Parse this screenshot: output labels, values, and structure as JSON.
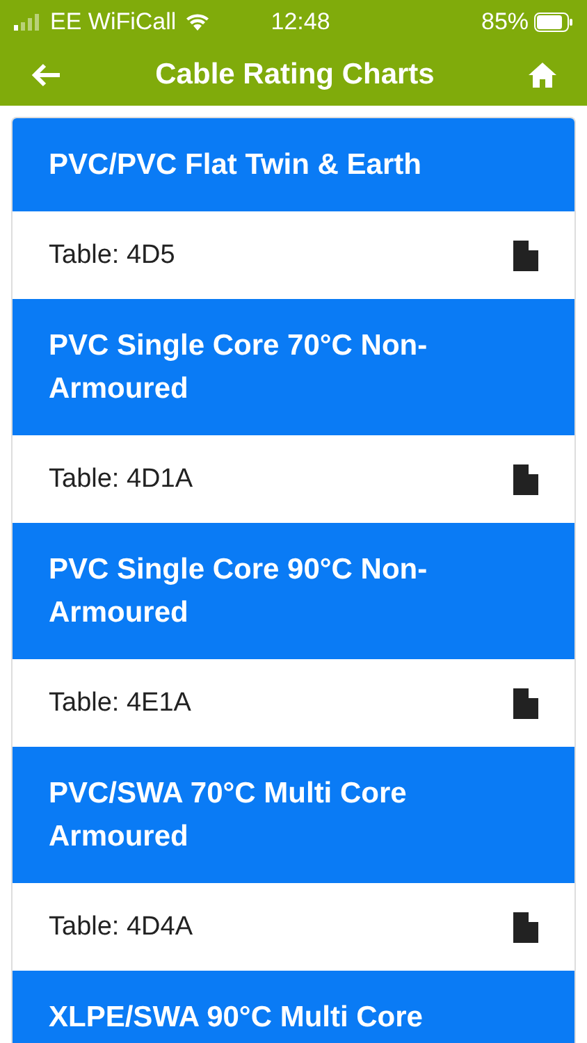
{
  "status_bar": {
    "carrier": "EE WiFiCall",
    "time": "12:48",
    "battery": "85%"
  },
  "header": {
    "title": "Cable Rating Charts"
  },
  "items": [
    {
      "title": "PVC/PVC Flat Twin & Earth",
      "table": "Table: 4D5"
    },
    {
      "title": "PVC Single Core 70°C Non-Armoured",
      "table": "Table: 4D1A"
    },
    {
      "title": "PVC Single Core 90°C Non-Armoured",
      "table": "Table: 4E1A"
    },
    {
      "title": "PVC/SWA 70°C Multi Core Armoured",
      "table": "Table: 4D4A"
    },
    {
      "title": "XLPE/SWA 90°C Multi Core"
    }
  ]
}
